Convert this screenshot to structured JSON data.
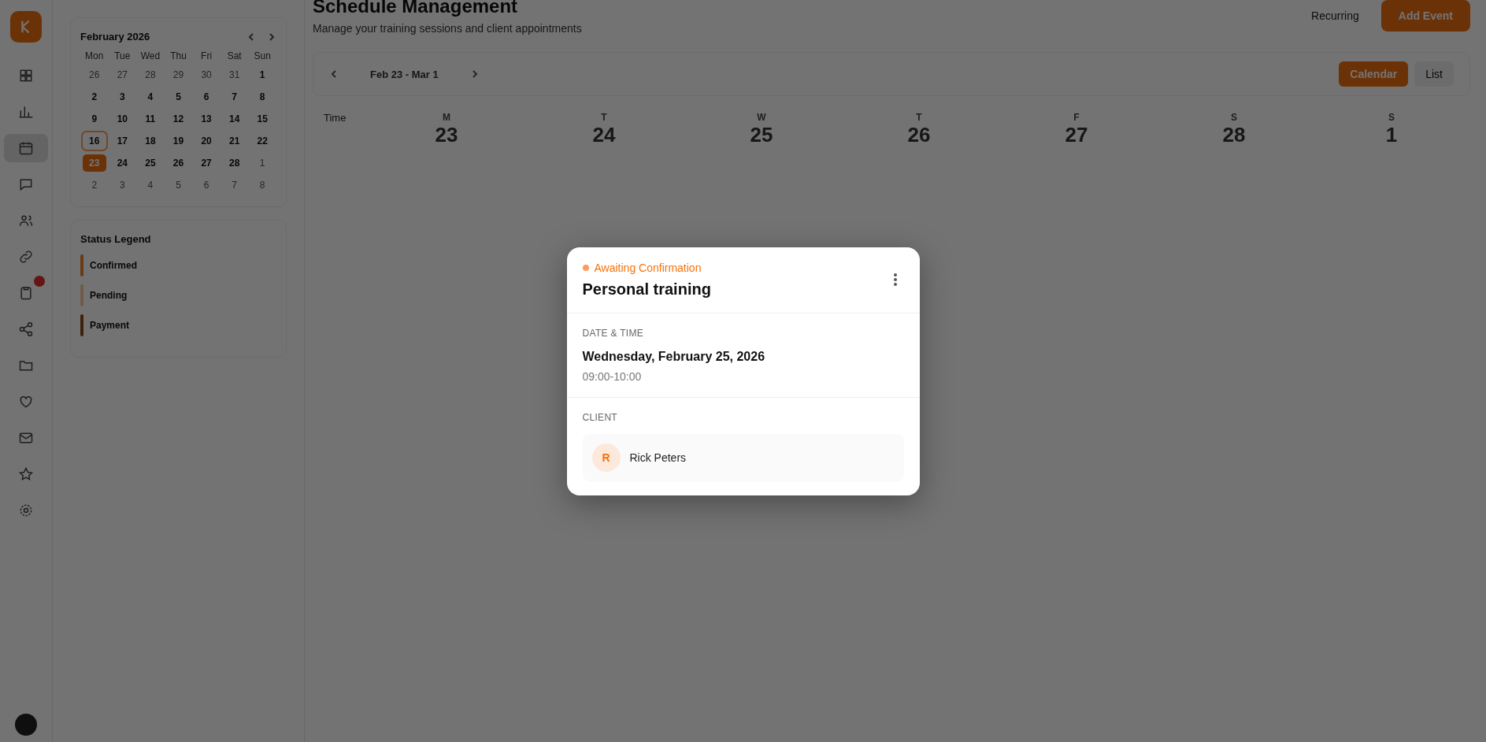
{
  "nav": [
    {
      "kind": "logo"
    },
    {
      "kind": "grid",
      "selected": false
    },
    {
      "kind": "chart",
      "selected": false
    },
    {
      "kind": "calendar",
      "selected": true
    },
    {
      "kind": "chat",
      "selected": false
    },
    {
      "kind": "users",
      "selected": false
    },
    {
      "kind": "link",
      "selected": false
    },
    {
      "kind": "clipboard",
      "selected": false,
      "badge": true
    },
    {
      "kind": "share",
      "selected": false
    },
    {
      "kind": "folder",
      "selected": false
    },
    {
      "kind": "heart",
      "selected": false
    },
    {
      "kind": "mail",
      "selected": false
    },
    {
      "kind": "star",
      "selected": false
    },
    {
      "kind": "gear",
      "selected": false
    }
  ],
  "mini_calendar": {
    "title": "February 2026",
    "weekdays": [
      "Mon",
      "Tue",
      "Wed",
      "Thu",
      "Fri",
      "Sat",
      "Sun"
    ],
    "days": [
      {
        "label": "26",
        "outside": true,
        "today": false,
        "selected": false
      },
      {
        "label": "27",
        "outside": true,
        "today": false,
        "selected": false
      },
      {
        "label": "28",
        "outside": true,
        "today": false,
        "selected": false
      },
      {
        "label": "29",
        "outside": true,
        "today": false,
        "selected": false
      },
      {
        "label": "30",
        "outside": true,
        "today": false,
        "selected": false
      },
      {
        "label": "31",
        "outside": true,
        "today": false,
        "selected": false
      },
      {
        "label": "1",
        "outside": false,
        "today": false,
        "selected": false
      },
      {
        "label": "2",
        "outside": false,
        "today": false,
        "selected": false
      },
      {
        "label": "3",
        "outside": false,
        "today": false,
        "selected": false
      },
      {
        "label": "4",
        "outside": false,
        "today": false,
        "selected": false
      },
      {
        "label": "5",
        "outside": false,
        "today": false,
        "selected": false
      },
      {
        "label": "6",
        "outside": false,
        "today": false,
        "selected": false
      },
      {
        "label": "7",
        "outside": false,
        "today": false,
        "selected": false
      },
      {
        "label": "8",
        "outside": false,
        "today": false,
        "selected": false
      },
      {
        "label": "9",
        "outside": false,
        "today": false,
        "selected": false
      },
      {
        "label": "10",
        "outside": false,
        "today": false,
        "selected": false
      },
      {
        "label": "11",
        "outside": false,
        "today": false,
        "selected": false
      },
      {
        "label": "12",
        "outside": false,
        "today": false,
        "selected": false
      },
      {
        "label": "13",
        "outside": false,
        "today": false,
        "selected": false
      },
      {
        "label": "14",
        "outside": false,
        "today": false,
        "selected": false
      },
      {
        "label": "15",
        "outside": false,
        "today": false,
        "selected": false
      },
      {
        "label": "16",
        "outside": false,
        "today": true,
        "selected": false
      },
      {
        "label": "17",
        "outside": false,
        "today": false,
        "selected": false
      },
      {
        "label": "18",
        "outside": false,
        "today": false,
        "selected": false
      },
      {
        "label": "19",
        "outside": false,
        "today": false,
        "selected": false
      },
      {
        "label": "20",
        "outside": false,
        "today": false,
        "selected": false
      },
      {
        "label": "21",
        "outside": false,
        "today": false,
        "selected": false
      },
      {
        "label": "22",
        "outside": false,
        "today": false,
        "selected": false
      },
      {
        "label": "23",
        "outside": false,
        "today": false,
        "selected": true
      },
      {
        "label": "24",
        "outside": false,
        "today": false,
        "selected": false
      },
      {
        "label": "25",
        "outside": false,
        "today": false,
        "selected": false
      },
      {
        "label": "26",
        "outside": false,
        "today": false,
        "selected": false
      },
      {
        "label": "27",
        "outside": false,
        "today": false,
        "selected": false
      },
      {
        "label": "28",
        "outside": false,
        "today": false,
        "selected": false
      },
      {
        "label": "1",
        "outside": true,
        "today": false,
        "selected": false
      },
      {
        "label": "2",
        "outside": true,
        "today": false,
        "selected": false
      },
      {
        "label": "3",
        "outside": true,
        "today": false,
        "selected": false
      },
      {
        "label": "4",
        "outside": true,
        "today": false,
        "selected": false
      },
      {
        "label": "5",
        "outside": true,
        "today": false,
        "selected": false
      },
      {
        "label": "6",
        "outside": true,
        "today": false,
        "selected": false
      },
      {
        "label": "7",
        "outside": true,
        "today": false,
        "selected": false
      },
      {
        "label": "8",
        "outside": true,
        "today": false,
        "selected": false
      }
    ]
  },
  "status_legend": {
    "title": "Status Legend",
    "items": [
      {
        "label": "Confirmed",
        "kind": "confirmed"
      },
      {
        "label": "Pending",
        "kind": "pending"
      },
      {
        "label": "Payment",
        "kind": "payment"
      }
    ]
  },
  "header": {
    "title": "Schedule Management",
    "subtitle": "Manage your training sessions and client appointments",
    "recurring": "Recurring",
    "add_button": "Add Event"
  },
  "toolbar": {
    "range": "Feb 23 - Mar 1",
    "views": [
      {
        "label": "Calendar",
        "selected": true
      },
      {
        "label": "List",
        "selected": false
      }
    ]
  },
  "week": {
    "time_label": "Time",
    "days": [
      {
        "letter": "M",
        "date": "23"
      },
      {
        "letter": "T",
        "date": "24"
      },
      {
        "letter": "W",
        "date": "25"
      },
      {
        "letter": "T",
        "date": "26"
      },
      {
        "letter": "F",
        "date": "27"
      },
      {
        "letter": "S",
        "date": "28"
      },
      {
        "letter": "S",
        "date": "1"
      }
    ]
  },
  "dialog": {
    "status": "Awaiting Confirmation",
    "title": "Personal training",
    "date_label": "DATE & TIME",
    "date": "Wednesday, February 25, 2026",
    "time": "09:00-10:00",
    "client_label": "CLIENT",
    "client_initial": "R",
    "client_name": "Rick Peters"
  }
}
